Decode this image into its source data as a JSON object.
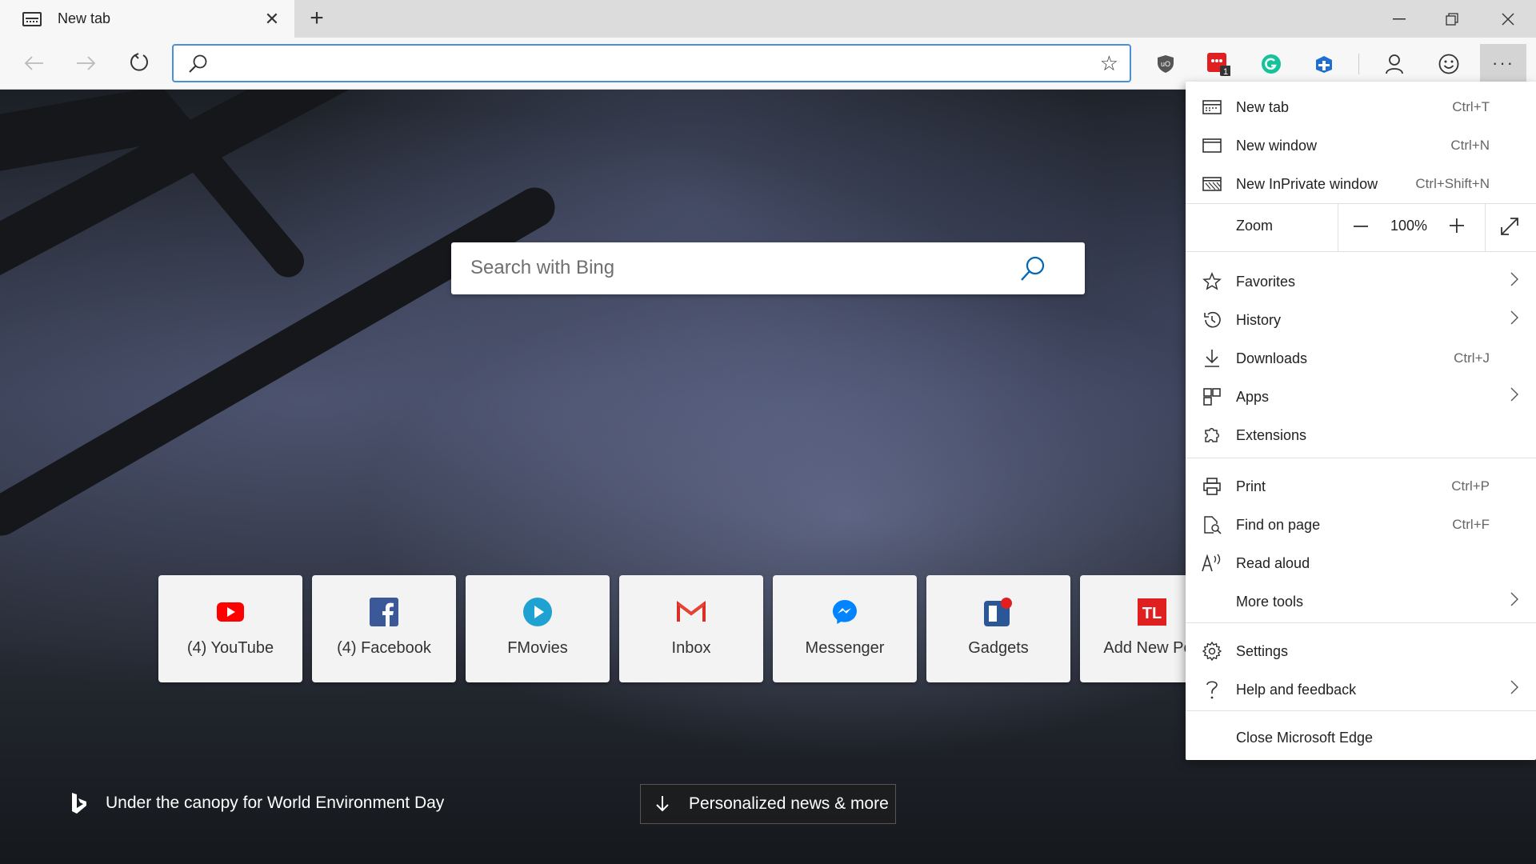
{
  "tab": {
    "title": "New tab"
  },
  "window_controls": {
    "minimize": "—",
    "restore": "❐",
    "close": "✕"
  },
  "address_bar": {
    "value": "",
    "placeholder": ""
  },
  "toolbar": {
    "extensions": [
      {
        "name": "ublock-icon",
        "color": "#555555"
      },
      {
        "name": "todo-extension-icon",
        "color": "#e02020",
        "badge": "1"
      },
      {
        "name": "grammarly-icon",
        "color": "#15c39a"
      },
      {
        "name": "extension-icon",
        "color": "#1e6fd0"
      }
    ],
    "more_label": "···"
  },
  "page": {
    "search_placeholder": "Search with Bing",
    "tiles": [
      {
        "label": "(4) YouTube",
        "icon": "youtube-icon",
        "color": "#ff0000"
      },
      {
        "label": "(4) Facebook",
        "icon": "facebook-icon",
        "color": "#3b5998"
      },
      {
        "label": "FMovies",
        "icon": "fmovies-icon",
        "color": "#1fa1d2"
      },
      {
        "label": "Inbox",
        "icon": "gmail-icon",
        "color": "#d93025"
      },
      {
        "label": "Messenger",
        "icon": "messenger-icon",
        "color": "#0084ff"
      },
      {
        "label": "Gadgets",
        "icon": "gadgets-icon",
        "color": "#2b5797"
      },
      {
        "label": "Add New Pos",
        "icon": "tl-icon",
        "color": "#e02020"
      }
    ],
    "caption": "Under the canopy for World Environment Day",
    "news_button": "Personalized news & more"
  },
  "menu": {
    "new_tab": {
      "label": "New tab",
      "shortcut": "Ctrl+T"
    },
    "new_window": {
      "label": "New window",
      "shortcut": "Ctrl+N"
    },
    "new_inprivate": {
      "label": "New InPrivate window",
      "shortcut": "Ctrl+Shift+N"
    },
    "zoom": {
      "label": "Zoom",
      "value": "100%",
      "minus": "—",
      "plus": "+"
    },
    "favorites": {
      "label": "Favorites"
    },
    "history": {
      "label": "History"
    },
    "downloads": {
      "label": "Downloads",
      "shortcut": "Ctrl+J"
    },
    "apps": {
      "label": "Apps"
    },
    "extensions": {
      "label": "Extensions"
    },
    "print": {
      "label": "Print",
      "shortcut": "Ctrl+P"
    },
    "find": {
      "label": "Find on page",
      "shortcut": "Ctrl+F"
    },
    "read_aloud": {
      "label": "Read aloud"
    },
    "more_tools": {
      "label": "More tools"
    },
    "settings": {
      "label": "Settings"
    },
    "help": {
      "label": "Help and feedback"
    },
    "close": {
      "label": "Close Microsoft Edge"
    }
  }
}
